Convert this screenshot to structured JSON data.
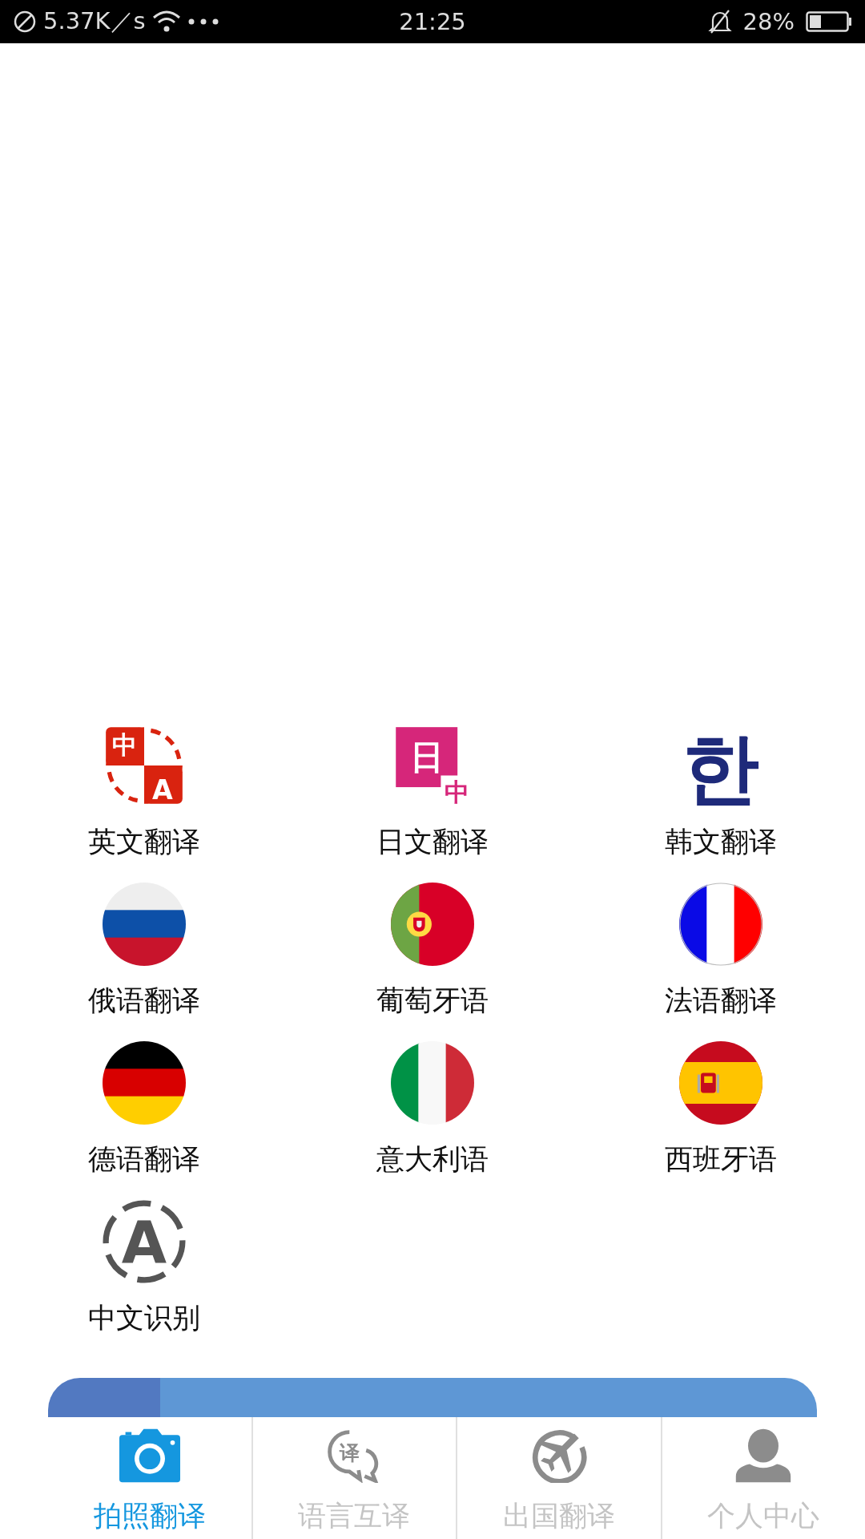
{
  "status_bar": {
    "speed": "5.37K／s",
    "time": "21:25",
    "battery": "28%"
  },
  "languages": [
    {
      "label": "英文翻译",
      "kind": "zh-en",
      "icon_text": [
        "中",
        "A"
      ]
    },
    {
      "label": "日文翻译",
      "kind": "ja",
      "icon_text": [
        "日",
        "中"
      ]
    },
    {
      "label": "韩文翻译",
      "kind": "ko",
      "icon_text": [
        "한"
      ]
    },
    {
      "label": "俄语翻译",
      "kind": "flag-ru"
    },
    {
      "label": "葡萄牙语",
      "kind": "flag-pt"
    },
    {
      "label": "法语翻译",
      "kind": "flag-fr"
    },
    {
      "label": "德语翻译",
      "kind": "flag-de"
    },
    {
      "label": "意大利语",
      "kind": "flag-it"
    },
    {
      "label": "西班牙语",
      "kind": "flag-es"
    },
    {
      "label": "中文识别",
      "kind": "ocr",
      "icon_text": [
        "A"
      ]
    }
  ],
  "tabs": [
    {
      "label": "拍照翻译",
      "kind": "camera",
      "selected": true
    },
    {
      "label": "语言互译",
      "kind": "chat",
      "selected": false,
      "icon_text": "译"
    },
    {
      "label": "出国翻译",
      "kind": "plane",
      "selected": false
    },
    {
      "label": "个人中心",
      "kind": "person",
      "selected": false
    }
  ]
}
